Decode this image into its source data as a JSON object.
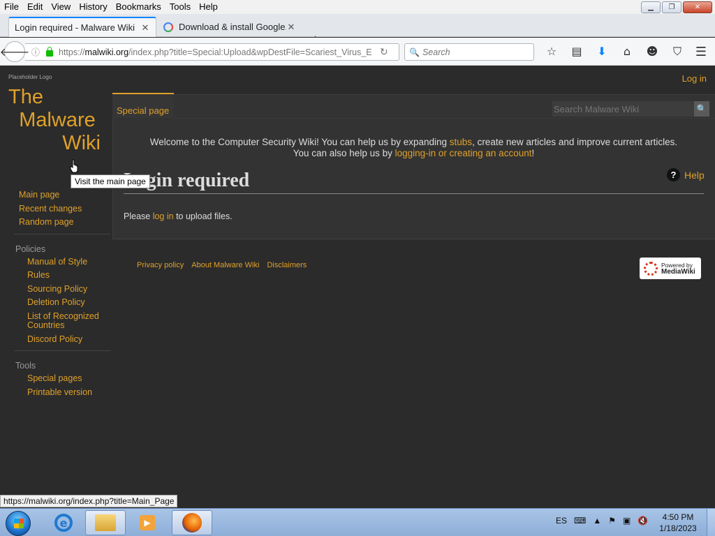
{
  "menu": [
    "File",
    "Edit",
    "View",
    "History",
    "Bookmarks",
    "Tools",
    "Help"
  ],
  "tabs": [
    {
      "label": "Login required - Malware Wiki"
    },
    {
      "label": "Download & install Google..."
    }
  ],
  "url": {
    "prefix": "https://",
    "domain": "malwiki.org",
    "path": "/index.php?title=Special:Upload&wpDestFile=Scariest_Virus_E"
  },
  "search_placeholder": "Search",
  "site": {
    "placeholder_logo": "Placeholder Logo",
    "logo_line1": "The",
    "logo_line2": "Malware",
    "logo_line3": "Wiki",
    "login": "Log in",
    "tab": "Special page",
    "search_placeholder": "Search Malware Wiki",
    "welcome1_a": "Welcome to the Computer Security Wiki! You can help us by expanding ",
    "welcome1_link": "stubs",
    "welcome1_b": ", create new articles and improve current articles.",
    "welcome2_a": "You can also help us by ",
    "welcome2_link": "logging-in or creating an account",
    "welcome2_b": "!",
    "heading": "Login required",
    "help": "Help",
    "please_a": "Please ",
    "please_link": "log in",
    "please_b": " to upload files.",
    "tooltip": "Visit the main page"
  },
  "sidebar": {
    "nav": [
      "Main page",
      "Recent changes",
      "Random page"
    ],
    "policies_title": "Policies",
    "policies": [
      "Manual of Style",
      "Rules",
      "Sourcing Policy",
      "Deletion Policy",
      "List of Recognized Countries",
      "Discord Policy"
    ],
    "tools_title": "Tools",
    "tools": [
      "Special pages",
      "Printable version"
    ]
  },
  "footer": [
    "Privacy policy",
    "About Malware Wiki",
    "Disclaimers"
  ],
  "poweredby": {
    "line1": "Powered by",
    "line2": "MediaWiki"
  },
  "status_url": "https://malwiki.org/index.php?title=Main_Page",
  "taskbar": {
    "lang": "ES",
    "time": "4:50 PM",
    "date": "1/18/2023"
  }
}
